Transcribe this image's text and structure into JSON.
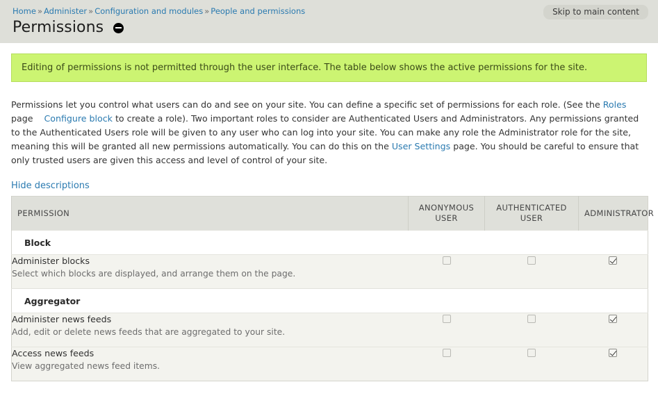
{
  "header": {
    "breadcrumb": [
      {
        "label": "Home",
        "link": true
      },
      {
        "label": "Administer",
        "link": true
      },
      {
        "label": "Configuration and modules",
        "link": true
      },
      {
        "label": "People and permissions",
        "link": true
      }
    ],
    "separator": "»",
    "title": "Permissions",
    "collapse_icon": "minus-circle-icon",
    "skip_link": "Skip to main content",
    "band_color": "#dedfd9"
  },
  "notice": {
    "text": "Editing of permissions is not permitted through the user interface. The table below shows the active permissions for the site.",
    "bg_color": "#ccf472",
    "border_color": "#b5dd5c"
  },
  "intro": {
    "p1": "Permissions let you control what users can do and see on your site. You can define a specific set of permissions for each role. (See the ",
    "roles_link": "Roles",
    "p2": " page",
    "configure_block_link": "Configure block",
    "p3": " to create a role). Two important roles to consider are Authenticated Users and Administrators. Any permissions granted to the Authenticated Users role will be given to any user who can log into your site. You can make any role the Administrator role for the site, meaning this will be granted all new permissions automatically. You can do this on the ",
    "user_settings_link": "User Settings",
    "p4": " page. You should be careful to ensure that only trusted users are given this access and level of control of your site."
  },
  "toggle_descriptions_label": "Hide descriptions",
  "table": {
    "columns": [
      {
        "key": "permission",
        "label": "PERMISSION"
      },
      {
        "key": "anonymous",
        "label": "ANONYMOUS USER"
      },
      {
        "key": "authenticated",
        "label": "AUTHENTICATED USER"
      },
      {
        "key": "administrator",
        "label": "ADMINISTRATOR"
      }
    ],
    "groups": [
      {
        "name": "Block",
        "rows": [
          {
            "title": "Administer blocks",
            "description": "Select which blocks are displayed, and arrange them on the page.",
            "anonymous": false,
            "authenticated": false,
            "administrator": true
          }
        ]
      },
      {
        "name": "Aggregator",
        "rows": [
          {
            "title": "Administer news feeds",
            "description": "Add, edit or delete news feeds that are aggregated to your site.",
            "anonymous": false,
            "authenticated": false,
            "administrator": true
          },
          {
            "title": "Access news feeds",
            "description": "View aggregated news feed items.",
            "anonymous": false,
            "authenticated": false,
            "administrator": true
          }
        ]
      }
    ]
  }
}
